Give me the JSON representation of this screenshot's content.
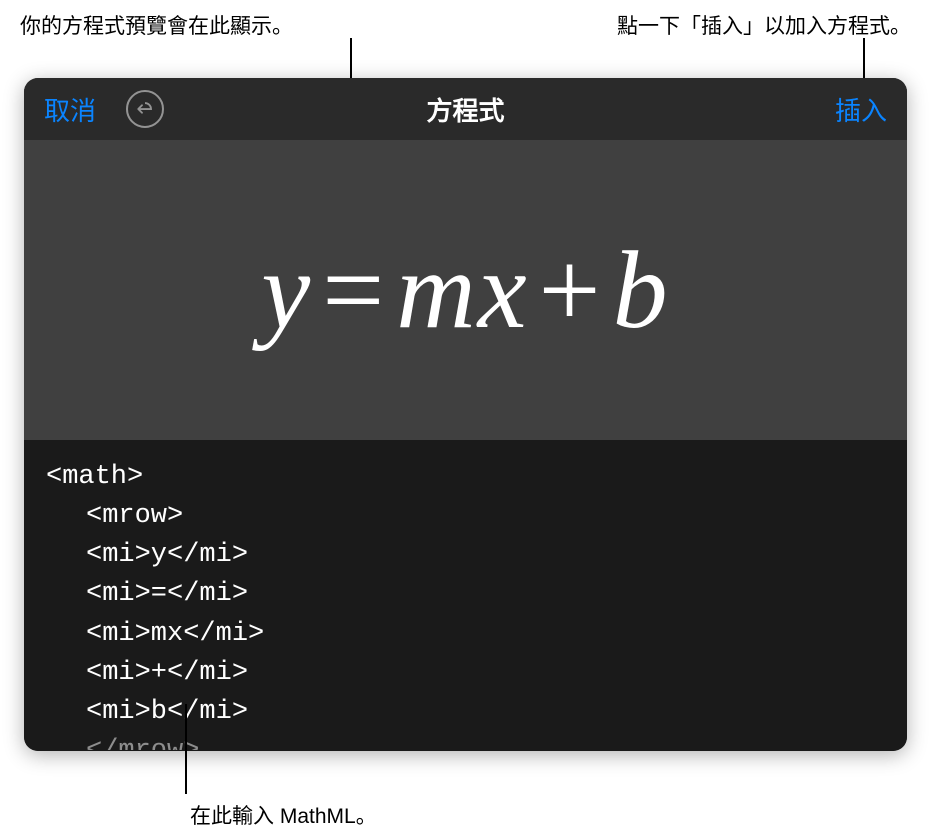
{
  "callouts": {
    "top_left": "你的方程式預覽會在此顯示。",
    "top_right": "點一下「插入」以加入方程式。",
    "bottom": "在此輸入 MathML。"
  },
  "toolbar": {
    "cancel_label": "取消",
    "title": "方程式",
    "insert_label": "插入"
  },
  "preview": {
    "eq_y": "y",
    "eq_eq": "=",
    "eq_mx": "mx",
    "eq_plus": "+",
    "eq_b": "b"
  },
  "code_lines": {
    "l0": "<math>",
    "l1": "<mrow>",
    "l2": "<mi>y</mi>",
    "l3": "<mi>=</mi>",
    "l4": "<mi>mx</mi>",
    "l5": "<mi>+</mi>",
    "l6": "<mi>b</mi>",
    "l7": "</mrow>"
  }
}
